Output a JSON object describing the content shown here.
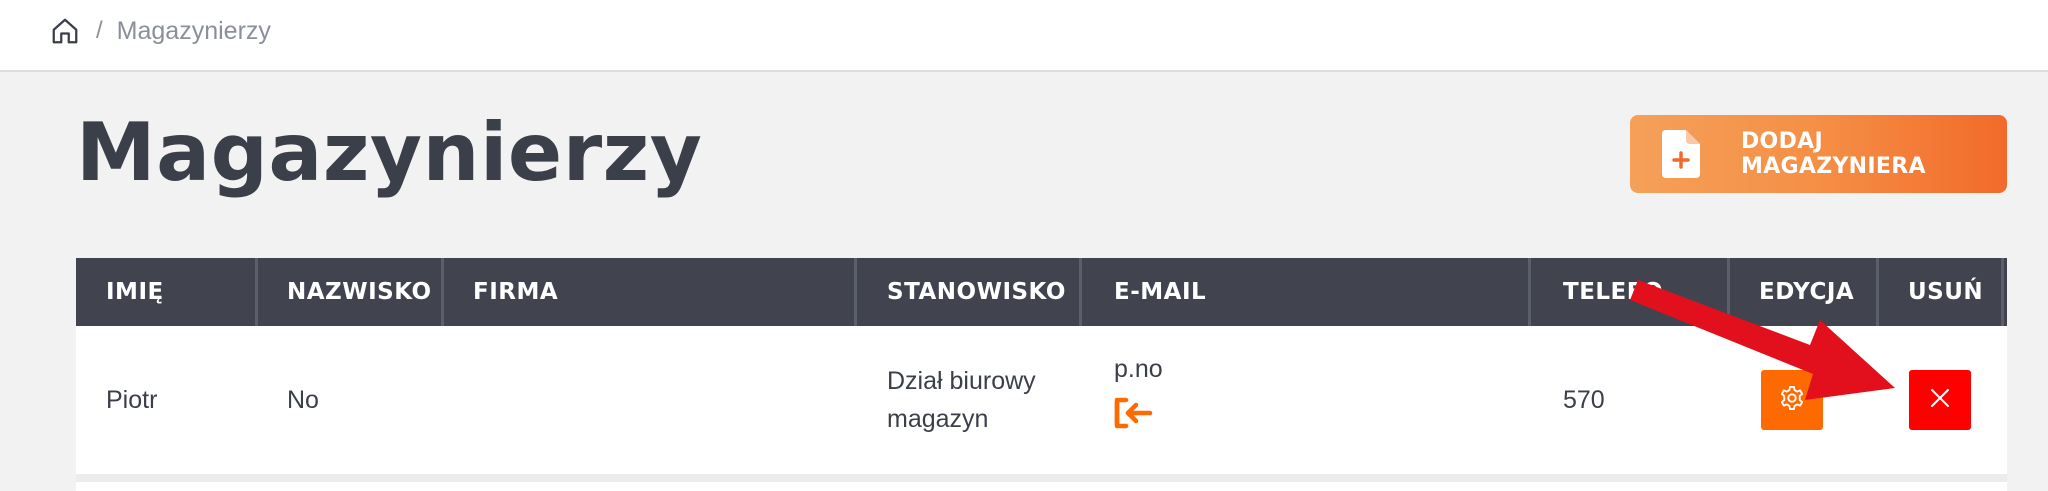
{
  "breadcrumb": {
    "home_icon": "home-icon",
    "separator": "/",
    "current": "Magazynierzy"
  },
  "page": {
    "title": "Magazynierzy",
    "add_button_label": "DODAJ MAGAZYNIERA",
    "add_button_icon": "file-plus-icon"
  },
  "table": {
    "columns": [
      "IMIĘ",
      "NAZWISKO",
      "FIRMA",
      "STANOWISKO",
      "E-MAIL",
      "TELEFO",
      "EDYCJA",
      "USUŃ"
    ],
    "rows": [
      {
        "first_name": "Piotr",
        "last_name": "No",
        "company": "",
        "position_line1": "Dział biurowy",
        "position_line2": "magazyn",
        "email": "p.no",
        "email_icon": "login-icon",
        "phone": "570",
        "edit_icon": "gear-icon",
        "delete_icon": "close-icon"
      }
    ]
  },
  "colors": {
    "header_bg": "#41434f",
    "accent_orange": "#ff6a00",
    "delete_red": "#ff0000",
    "arrow_red": "#e1101c"
  }
}
